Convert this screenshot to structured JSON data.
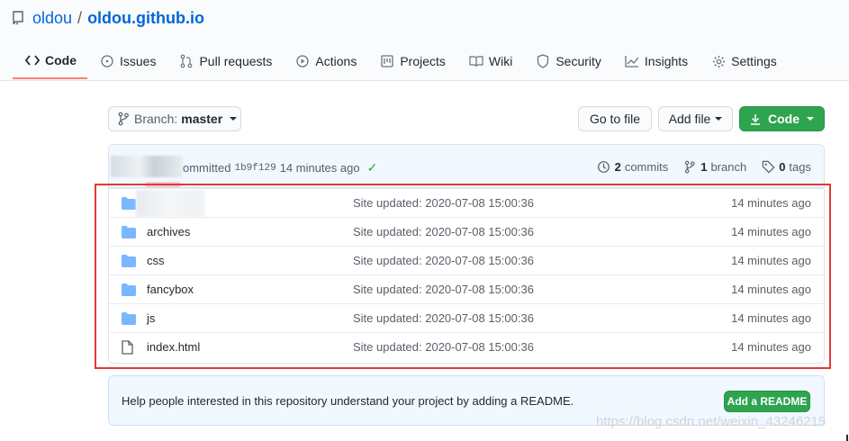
{
  "repo": {
    "owner": "oldou",
    "separator": "/",
    "name": "oldou.github.io"
  },
  "tabs": [
    {
      "label": "Code",
      "icon": "code-icon",
      "selected": true
    },
    {
      "label": "Issues",
      "icon": "issue-icon"
    },
    {
      "label": "Pull requests",
      "icon": "pull-request-icon"
    },
    {
      "label": "Actions",
      "icon": "play-icon"
    },
    {
      "label": "Projects",
      "icon": "project-icon"
    },
    {
      "label": "Wiki",
      "icon": "book-icon"
    },
    {
      "label": "Security",
      "icon": "shield-icon"
    },
    {
      "label": "Insights",
      "icon": "graph-icon"
    },
    {
      "label": "Settings",
      "icon": "gear-icon"
    }
  ],
  "toolbar": {
    "branch_prefix": "Branch:",
    "branch_name": "master",
    "go_to_file": "Go to file",
    "add_file": "Add file",
    "code": "Code"
  },
  "commit": {
    "message": "ommitted",
    "sha": "1b9f129",
    "age": "14 minutes ago",
    "check": "✓",
    "commits_count": "2",
    "commits_label": "commits",
    "branches_count": "1",
    "branches_label": "branch",
    "tags_count": "0",
    "tags_label": "tags"
  },
  "files": [
    {
      "type": "folder",
      "name": "",
      "message": "Site updated: 2020-07-08 15:00:36",
      "age": "14 minutes ago"
    },
    {
      "type": "folder",
      "name": "archives",
      "message": "Site updated: 2020-07-08 15:00:36",
      "age": "14 minutes ago"
    },
    {
      "type": "folder",
      "name": "css",
      "message": "Site updated: 2020-07-08 15:00:36",
      "age": "14 minutes ago"
    },
    {
      "type": "folder",
      "name": "fancybox",
      "message": "Site updated: 2020-07-08 15:00:36",
      "age": "14 minutes ago"
    },
    {
      "type": "folder",
      "name": "js",
      "message": "Site updated: 2020-07-08 15:00:36",
      "age": "14 minutes ago"
    },
    {
      "type": "file",
      "name": "index.html",
      "message": "Site updated: 2020-07-08 15:00:36",
      "age": "14 minutes ago"
    }
  ],
  "readme": {
    "text": "Help people interested in this repository understand your project by adding a README.",
    "button": "Add a README"
  },
  "watermark": "https://blog.csdn.net/weixin_43246215",
  "colors": {
    "link": "#0366d6",
    "green": "#2ea44f",
    "tab_underline": "#f9826c",
    "highlight": "#e53935",
    "folder": "#79b8ff"
  }
}
